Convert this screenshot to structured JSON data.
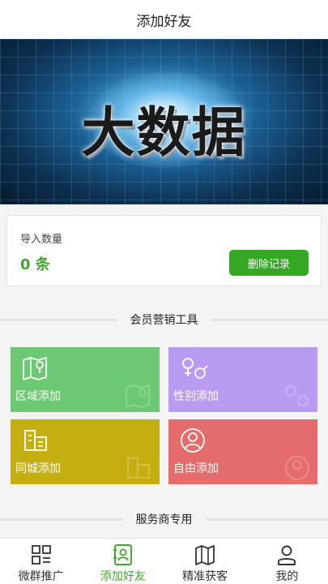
{
  "header": {
    "title": "添加好友"
  },
  "banner": {
    "text": "大数据"
  },
  "import_card": {
    "label": "导入数量",
    "count": "0 条",
    "delete_button": "删除记录"
  },
  "sections": {
    "member_tools": "会员营销工具",
    "provider": "服务商专用"
  },
  "tiles": [
    {
      "label": "区域添加",
      "icon": "map-icon",
      "color": "#6cc872"
    },
    {
      "label": "性别添加",
      "icon": "gender-icon",
      "color": "#b99cf2"
    },
    {
      "label": "同城添加",
      "icon": "building-icon",
      "color": "#c5ae10"
    },
    {
      "label": "自由添加",
      "icon": "user-circle-icon",
      "color": "#e46c6c"
    }
  ],
  "nav": [
    {
      "label": "微群推广",
      "icon": "grid-icon",
      "active": false
    },
    {
      "label": "添加好友",
      "icon": "contact-card-icon",
      "active": true
    },
    {
      "label": "精准获客",
      "icon": "map-icon",
      "active": false
    },
    {
      "label": "我的",
      "icon": "user-icon",
      "active": false
    }
  ],
  "colors": {
    "accent": "#3ea82b",
    "button": "#34a822",
    "indicator": "#e8283a"
  }
}
